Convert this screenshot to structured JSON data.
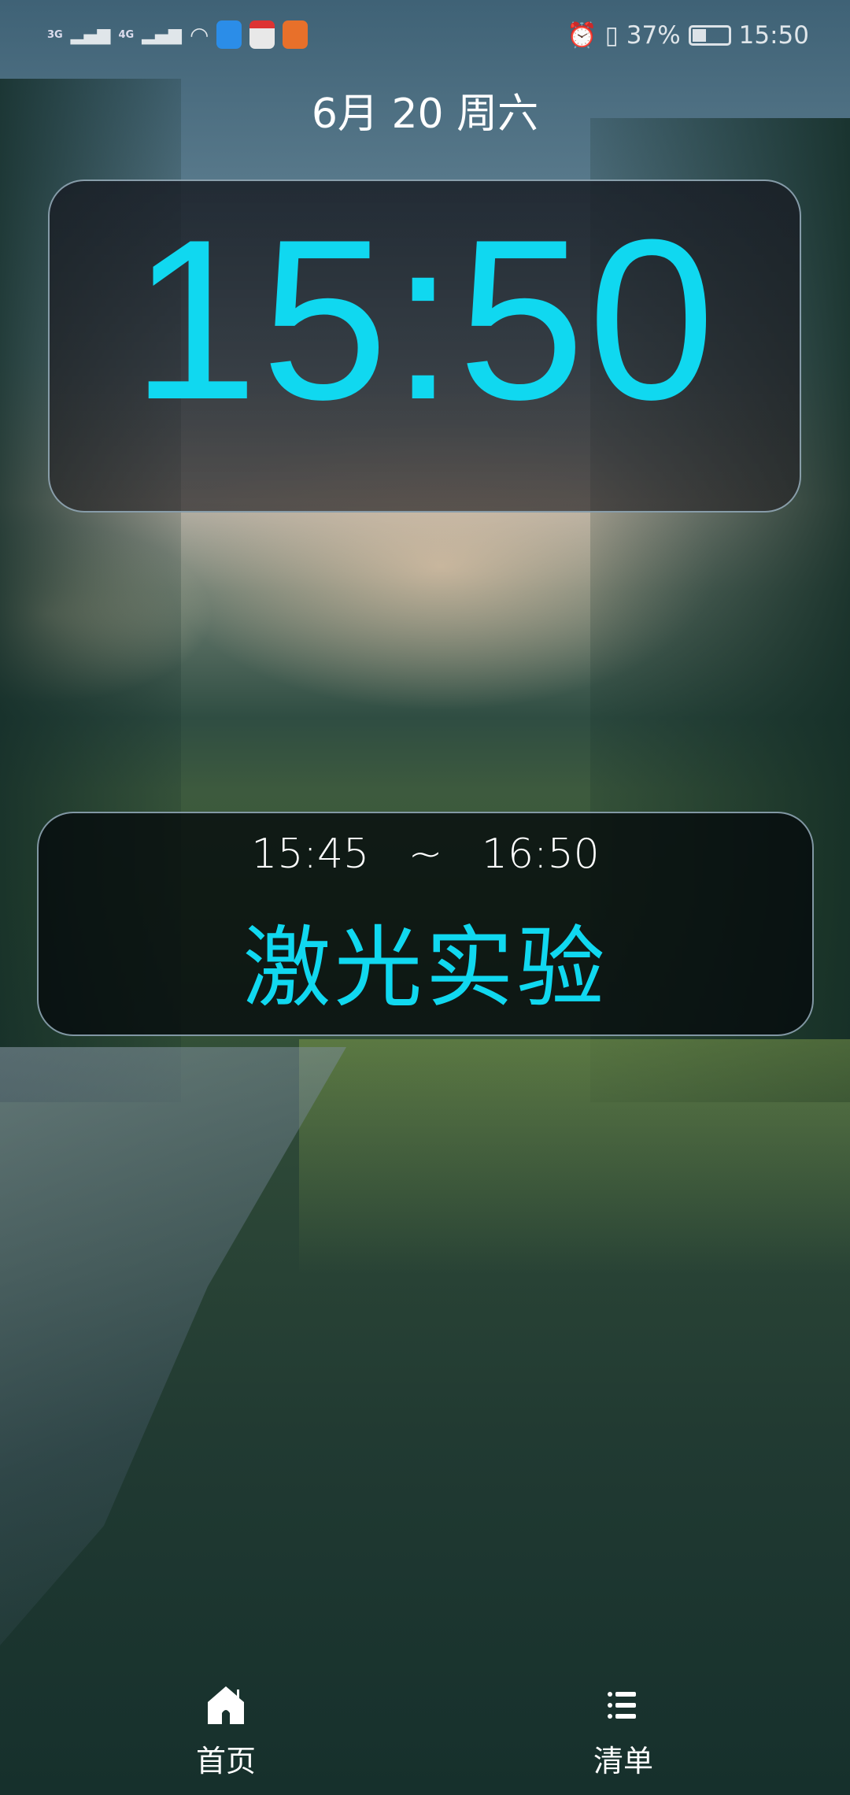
{
  "status_bar": {
    "network1": "3G",
    "network2": "4G",
    "battery": "37%",
    "battery_level": 0.37,
    "time": "15:50",
    "app_colors": [
      "#2b8de8",
      "#e8e8e8",
      "#e8702a"
    ]
  },
  "date": "6月 20 周六",
  "clock": "15:50",
  "event": {
    "start": "15:45",
    "separator": "~",
    "end": "16:50",
    "title": "激光实验"
  },
  "nav": [
    {
      "label": "首页",
      "icon": "home-icon"
    },
    {
      "label": "清单",
      "icon": "list-icon"
    }
  ],
  "accent": "#10d8f0"
}
